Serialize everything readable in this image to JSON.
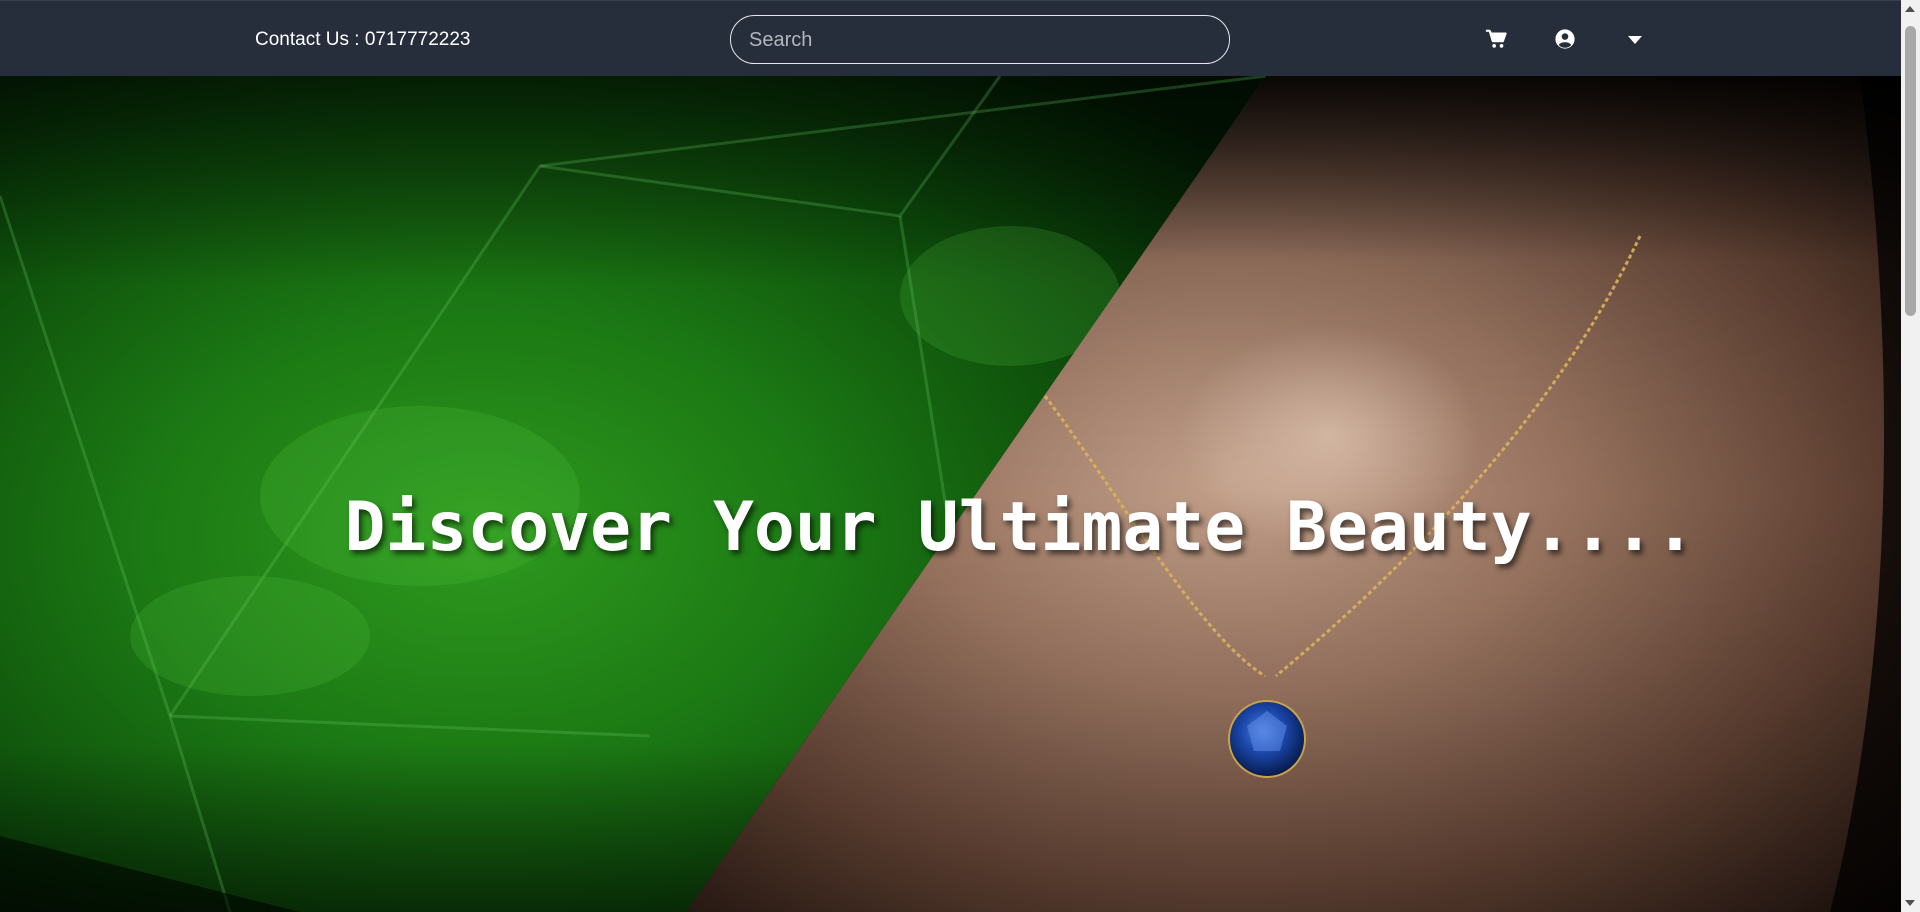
{
  "header": {
    "contact_text": "Contact Us : 0717772223",
    "search_placeholder": "Search",
    "icons": [
      "cart-icon",
      "user-circle-icon",
      "caret-down-icon"
    ]
  },
  "hero": {
    "title": "Discover Your Ultimate Beauty...."
  },
  "colors": {
    "navbar_bg": "#262d3b",
    "text": "#ffffff",
    "emerald": "#1f8a1f",
    "skin": "#8a6450",
    "sapphire": "#1a45a8"
  }
}
